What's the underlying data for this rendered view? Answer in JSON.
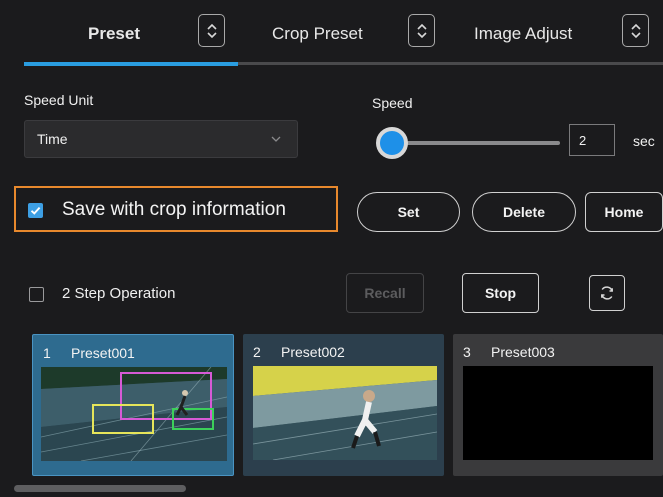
{
  "tabs": [
    {
      "label": "Preset",
      "active": true
    },
    {
      "label": "Crop Preset",
      "active": false
    },
    {
      "label": "Image Adjust",
      "active": false
    }
  ],
  "speed_unit": {
    "label": "Speed Unit",
    "value": "Time"
  },
  "speed": {
    "label": "Speed",
    "value": "2",
    "unit": "sec"
  },
  "save_crop": {
    "label": "Save with crop information",
    "checked": true
  },
  "buttons": {
    "set": "Set",
    "delete": "Delete",
    "home": "Home",
    "recall": "Recall",
    "stop": "Stop"
  },
  "two_step": {
    "label": "2 Step Operation",
    "checked": false
  },
  "presets": [
    {
      "num": "1",
      "name": "Preset001"
    },
    {
      "num": "2",
      "name": "Preset002"
    },
    {
      "num": "3",
      "name": "Preset003"
    }
  ],
  "colors": {
    "accent": "#2a9de0",
    "highlight": "#e8892d",
    "selected_card": "#2e6b8f"
  },
  "icons": [
    "up-down-spinner-icon",
    "chevron-down-icon",
    "refresh-icon",
    "checkmark-icon"
  ]
}
